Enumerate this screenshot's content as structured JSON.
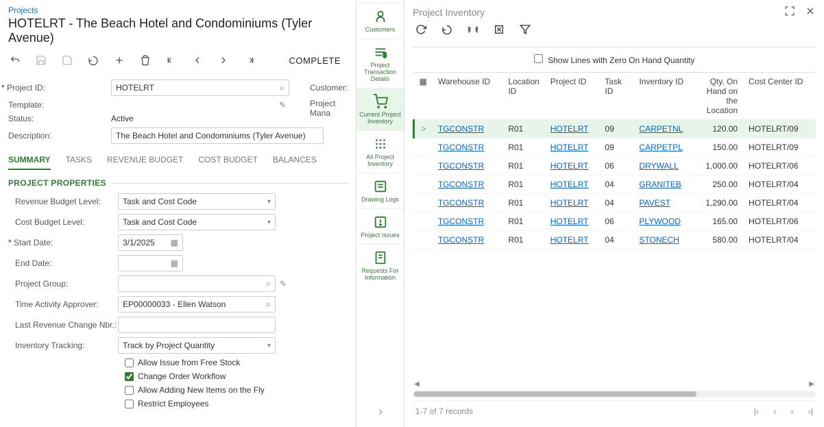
{
  "breadcrumb": "Projects",
  "pageTitle": "HOTELRT - The Beach Hotel and Condominiums (Tyler Avenue)",
  "completeLabel": "COMPLETE",
  "form": {
    "projectIdLabel": "Project ID:",
    "projectIdValue": "HOTELRT",
    "customerLabel": "Customer:",
    "templateLabel": "Template:",
    "projectManaLabel": "Project Mana",
    "statusLabel": "Status:",
    "statusValue": "Active",
    "descriptionLabel": "Description:",
    "descriptionValue": "The Beach Hotel and Condominiums (Tyler Avenue)"
  },
  "tabs": {
    "summary": "SUMMARY",
    "tasks": "TASKS",
    "revenueBudget": "REVENUE BUDGET",
    "costBudget": "COST BUDGET",
    "balances": "BALANCES"
  },
  "sectionHeader": "PROJECT PROPERTIES",
  "props": {
    "revenueBudgetLevelLabel": "Revenue Budget Level:",
    "revenueBudgetLevelValue": "Task and Cost Code",
    "costBudgetLevelLabel": "Cost Budget Level:",
    "costBudgetLevelValue": "Task and Cost Code",
    "startDateLabel": "Start Date:",
    "startDateValue": "3/1/2025",
    "endDateLabel": "End Date:",
    "endDateValue": "",
    "projectGroupLabel": "Project Group:",
    "projectGroupValue": "",
    "timeApproverLabel": "Time Activity Approver:",
    "timeApproverValue": "EP00000033 - Ellen Watson",
    "lastRevLabel": "Last Revenue Change Nbr.:",
    "lastRevValue": "",
    "inventoryTrackingLabel": "Inventory Tracking:",
    "inventoryTrackingValue": "Track by Project Quantity",
    "allowFreeStock": "Allow Issue from Free Stock",
    "changeOrderWorkflow": "Change Order Workflow",
    "allowNewItems": "Allow Adding New Items on the Fly",
    "restrictEmployees": "Restrict Employees"
  },
  "sideNav": {
    "customers": "Customers",
    "projectTransDetails": "Project Transaction Details",
    "currentInventory": "Current Project Inventory",
    "allProjectInventory": "All Project Inventory",
    "drawingLogs": "Drawing Logs",
    "projectIssues": "Project Issues",
    "rfi": "Requests For Information"
  },
  "right": {
    "title": "Project Inventory",
    "zeroLabel": "Show Lines with Zero On Hand Quantity",
    "columns": {
      "warehouse": "Warehouse ID",
      "location": "Location ID",
      "project": "Project ID",
      "task": "Task ID",
      "inventory": "Inventory ID",
      "qty": "Qty. On Hand on the Location",
      "costCenter": "Cost Center ID"
    },
    "rows": [
      {
        "warehouse": "TGCONSTR",
        "location": "R01",
        "project": "HOTELRT",
        "task": "09",
        "inventory": "CARPETNL",
        "qty": "120.00",
        "costCenter": "HOTELRT/09"
      },
      {
        "warehouse": "TGCONSTR",
        "location": "R01",
        "project": "HOTELRT",
        "task": "09",
        "inventory": "CARPETPL",
        "qty": "150.00",
        "costCenter": "HOTELRT/09"
      },
      {
        "warehouse": "TGCONSTR",
        "location": "R01",
        "project": "HOTELRT",
        "task": "06",
        "inventory": "DRYWALL",
        "qty": "1,000.00",
        "costCenter": "HOTELRT/06"
      },
      {
        "warehouse": "TGCONSTR",
        "location": "R01",
        "project": "HOTELRT",
        "task": "04",
        "inventory": "GRANITEB",
        "qty": "250.00",
        "costCenter": "HOTELRT/04"
      },
      {
        "warehouse": "TGCONSTR",
        "location": "R01",
        "project": "HOTELRT",
        "task": "04",
        "inventory": "PAVEST",
        "qty": "1,290.00",
        "costCenter": "HOTELRT/04"
      },
      {
        "warehouse": "TGCONSTR",
        "location": "R01",
        "project": "HOTELRT",
        "task": "06",
        "inventory": "PLYWOOD",
        "qty": "165.00",
        "costCenter": "HOTELRT/06"
      },
      {
        "warehouse": "TGCONSTR",
        "location": "R01",
        "project": "HOTELRT",
        "task": "04",
        "inventory": "STONECH",
        "qty": "580.00",
        "costCenter": "HOTELRT/04"
      }
    ],
    "footerStatus": "1-7 of 7 records"
  }
}
